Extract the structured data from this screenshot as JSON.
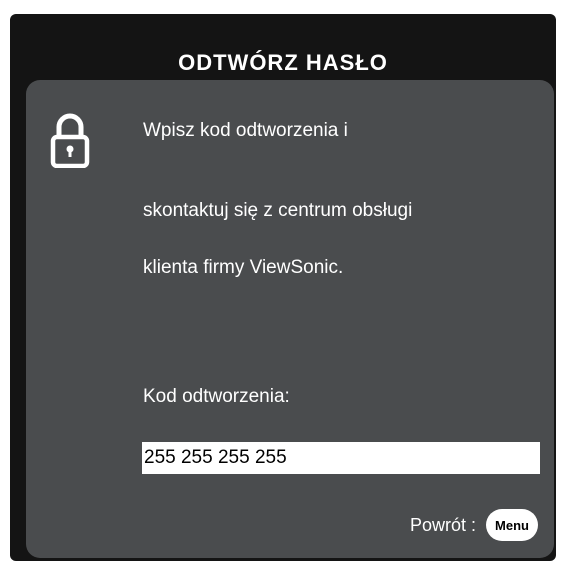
{
  "dialog": {
    "title": "ODTWÓRZ HASŁO"
  },
  "message": {
    "lines": [
      "Wpisz kod odtworzenia i",
      "skontaktuj się z centrum obsługi",
      "klienta firmy ViewSonic."
    ]
  },
  "recovery": {
    "label": "Kod odtworzenia:",
    "code": "255 255 255 255"
  },
  "footer": {
    "back_label": "Powrót :",
    "menu_button": "Menu"
  },
  "icons": {
    "lock": "lock-icon"
  },
  "colors": {
    "dialog_bg": "#141414",
    "panel_bg": "#4a4c4e",
    "text": "#ffffff"
  }
}
